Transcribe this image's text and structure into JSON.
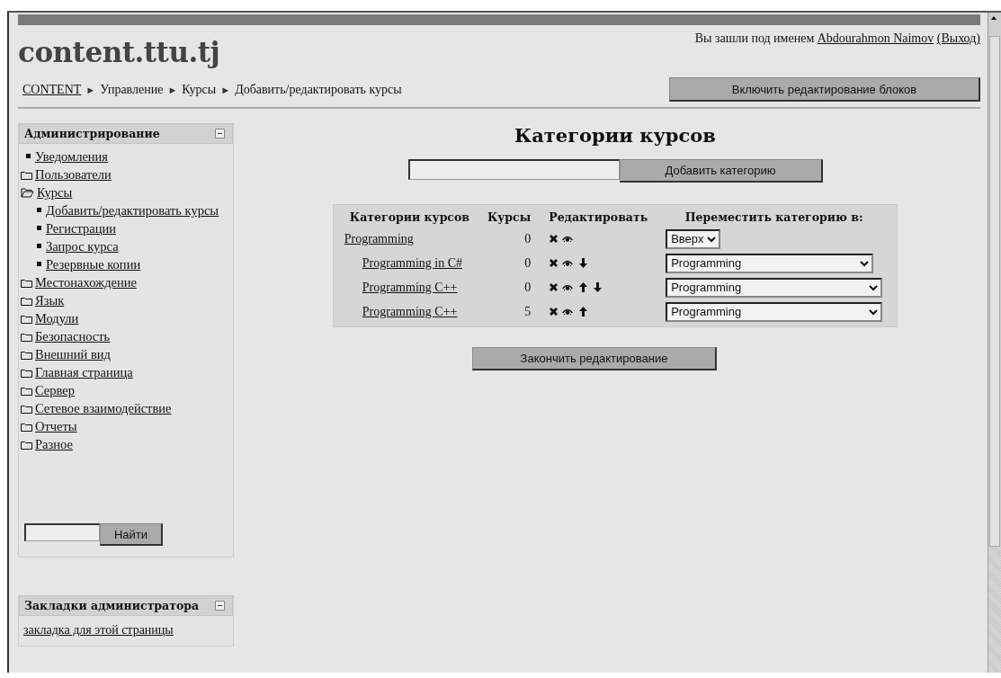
{
  "header": {
    "site_title": "content.ttu.tj",
    "login_text": "Вы зашли под именем",
    "user_name": "Abdourahmon Naimov",
    "logout_link": "(Выход)"
  },
  "breadcrumb": [
    {
      "label": "CONTENT",
      "kind": "link"
    },
    {
      "label": "►",
      "kind": "separator"
    },
    {
      "label": "Управление",
      "kind": "text"
    },
    {
      "label": "►",
      "kind": "separator"
    },
    {
      "label": "Курсы",
      "kind": "text"
    },
    {
      "label": "►",
      "kind": "separator"
    },
    {
      "label": "Добавить/редактировать курсы",
      "kind": "text"
    }
  ],
  "edit_blocks_button": "Включить редактирование блоков",
  "admin_block": {
    "title": "Администрирование",
    "items": [
      {
        "label": "Уведомления",
        "kind": "item"
      },
      {
        "label": "Пользователи",
        "kind": "folder",
        "expanded": false
      },
      {
        "label": "Курсы",
        "kind": "folder",
        "expanded": true,
        "children": [
          {
            "label": "Добавить/редактировать курсы",
            "kind": "item"
          },
          {
            "label": "Регистрации",
            "kind": "item"
          },
          {
            "label": "Запрос курса",
            "kind": "item"
          },
          {
            "label": "Резервные копии",
            "kind": "item"
          }
        ]
      },
      {
        "label": "Местонахождение",
        "kind": "folder",
        "expanded": false
      },
      {
        "label": "Язык",
        "kind": "folder",
        "expanded": false
      },
      {
        "label": "Модули",
        "kind": "folder",
        "expanded": false
      },
      {
        "label": "Безопасность",
        "kind": "folder",
        "expanded": false
      },
      {
        "label": "Внешний вид",
        "kind": "folder",
        "expanded": false
      },
      {
        "label": "Главная страница",
        "kind": "folder",
        "expanded": false
      },
      {
        "label": "Сервер",
        "kind": "folder",
        "expanded": false
      },
      {
        "label": "Сетевое взаимодействие",
        "kind": "folder",
        "expanded": false
      },
      {
        "label": "Отчеты",
        "kind": "folder",
        "expanded": false
      },
      {
        "label": "Разное",
        "kind": "folder",
        "expanded": false
      }
    ],
    "search_button": "Найти"
  },
  "bookmarks_block": {
    "title": "Закладки администратора",
    "link": "закладка для этой страницы"
  },
  "main": {
    "heading": "Категории курсов",
    "add_button": "Добавить категорию",
    "columns": [
      "Категории курсов",
      "Курсы",
      "Редактировать",
      "Переместить категорию в:"
    ],
    "rows": [
      {
        "name": "Programming",
        "courses": "0",
        "can_move_up": false,
        "can_move_down": false,
        "move_to": "Вверх",
        "children": [
          {
            "name": "Programming in C#",
            "courses": "0",
            "can_move_up": false,
            "can_move_down": true,
            "move_to": "Programming"
          },
          {
            "name": "Programming C++",
            "courses": "0",
            "can_move_up": true,
            "can_move_down": true,
            "move_to": "Programming"
          },
          {
            "name": "Programming C++",
            "courses": "5",
            "can_move_up": true,
            "can_move_down": false,
            "move_to": "Programming"
          }
        ]
      }
    ],
    "finish_button": "Закончить редактирование"
  }
}
